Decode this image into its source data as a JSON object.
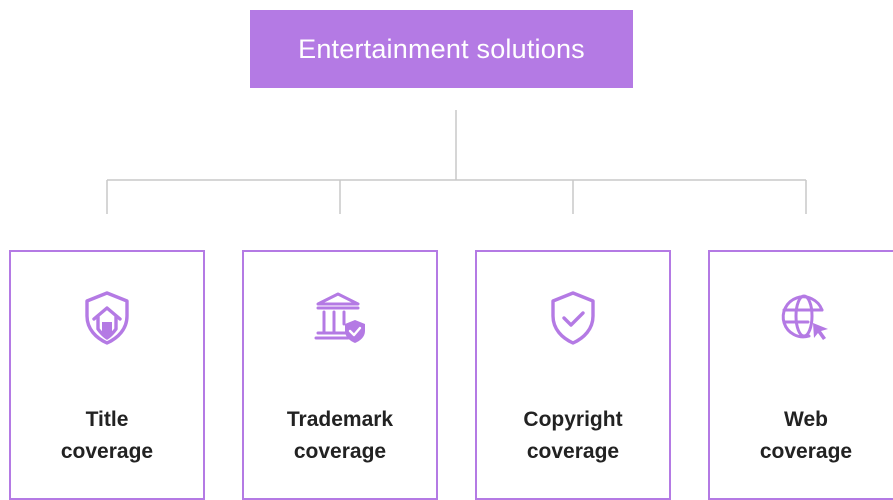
{
  "root": {
    "label": "Entertainment solutions"
  },
  "colors": {
    "accent": "#b47ae4",
    "connector": "#c8c8c8",
    "text": "#222222"
  },
  "children": [
    {
      "icon": "shield-home-icon",
      "line1": "Title",
      "line2": "coverage"
    },
    {
      "icon": "bank-shield-icon",
      "line1": "Trademark",
      "line2": "coverage"
    },
    {
      "icon": "shield-check-icon",
      "line1": "Copyright",
      "line2": "coverage"
    },
    {
      "icon": "globe-cursor-icon",
      "line1": "Web",
      "line2": "coverage"
    }
  ]
}
